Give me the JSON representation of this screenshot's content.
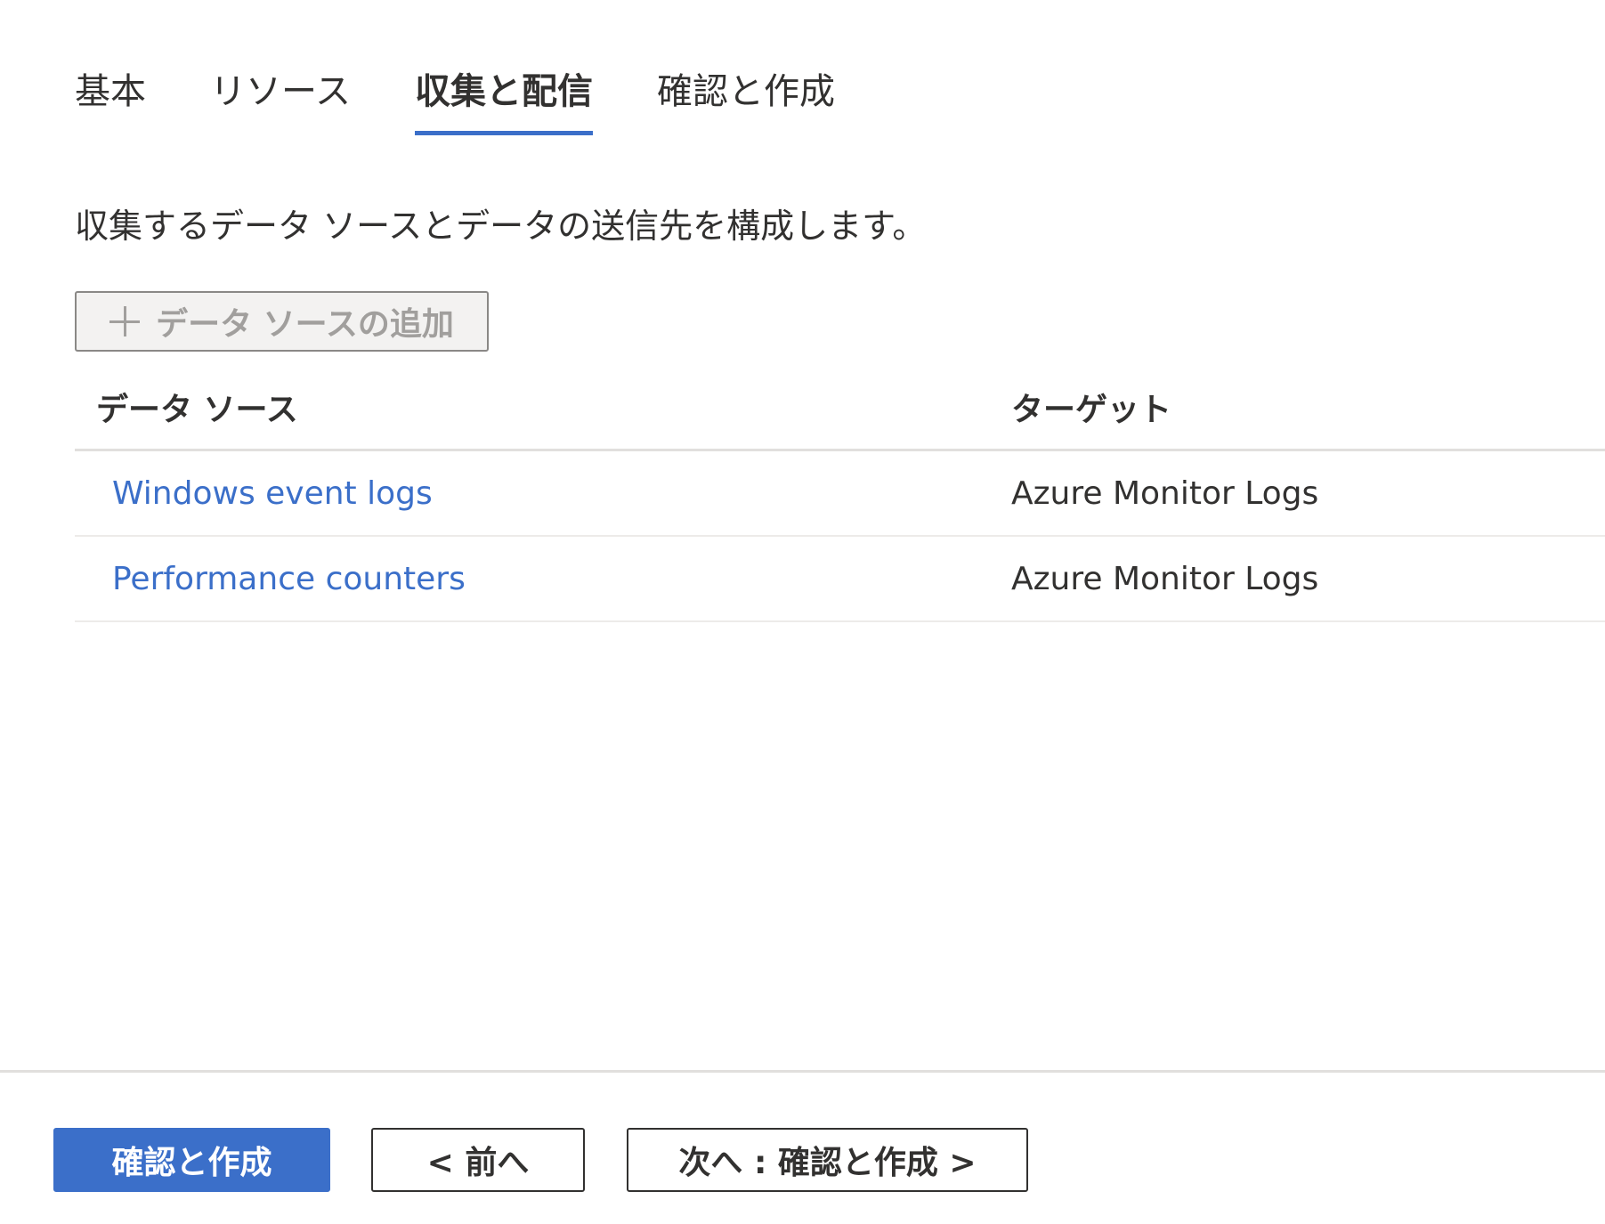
{
  "tabs": [
    {
      "label": "基本",
      "selected": false
    },
    {
      "label": "リソース",
      "selected": false
    },
    {
      "label": "収集と配信",
      "selected": true
    },
    {
      "label": "確認と作成",
      "selected": false
    }
  ],
  "description": "収集するデータ ソースとデータの送信先を構成します。",
  "add_button": {
    "icon": "plus-icon",
    "label": "データ ソースの追加"
  },
  "table": {
    "headers": {
      "source": "データ ソース",
      "target": "ターゲット"
    },
    "rows": [
      {
        "source": "Windows event logs",
        "target": "Azure Monitor Logs"
      },
      {
        "source": "Performance counters",
        "target": "Azure Monitor Logs"
      }
    ]
  },
  "footer": {
    "review_create": "確認と作成",
    "previous": "< 前へ",
    "next": "次へ : 確認と作成 >"
  },
  "colors": {
    "accent": "#3b6fc9",
    "text": "#323130",
    "disabled_text": "#a19f9d",
    "divider": "#e1dfdd"
  }
}
